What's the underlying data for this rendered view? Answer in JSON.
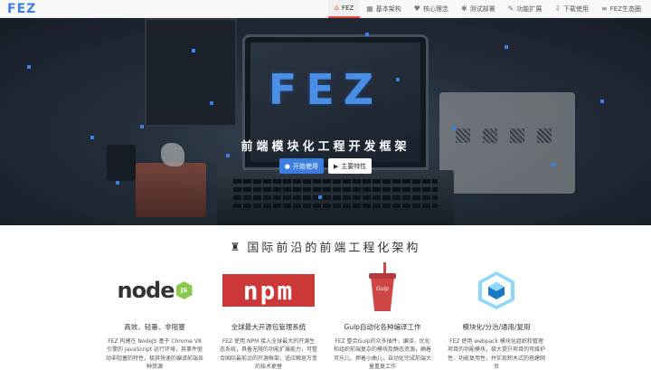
{
  "brand": {
    "name": "FEZ"
  },
  "nav": {
    "items": [
      {
        "label": "FEZ",
        "icon": "home-icon",
        "glyph": "⌂",
        "active": true
      },
      {
        "label": "基本架构",
        "icon": "grid-icon",
        "glyph": "▦"
      },
      {
        "label": "核心理念",
        "icon": "heart-icon",
        "glyph": "♥"
      },
      {
        "label": "测试部署",
        "icon": "bug-icon",
        "glyph": "✱"
      },
      {
        "label": "功能扩展",
        "icon": "tools-icon",
        "glyph": "✎"
      },
      {
        "label": "下载使用",
        "icon": "download-icon",
        "glyph": "⇩"
      },
      {
        "label": "FEZ生态圈",
        "icon": "bars-icon",
        "glyph": "≡"
      }
    ]
  },
  "hero": {
    "logo": "FEZ",
    "subtitle": "前端模块化工程开发框架",
    "btn_start": "开始使用",
    "btn_features": "主要特性"
  },
  "section": {
    "title": "国际前沿的前端工程化架构"
  },
  "features": [
    {
      "logo": "node",
      "logo_text": "node",
      "logo_badge": "JS",
      "title": "高效、轻量、非阻塞",
      "desc": "FEZ 构建在 NodeJS 基于 Chrome V8 引擎的 JavaScript 运行环境，其事件驱动非阻塞的特性，极其快速的编译前端各种资源"
    },
    {
      "logo": "npm",
      "logo_text": "npm",
      "title": "全球最大开源包管理系统",
      "desc": "FEZ 使用 NPM 接入全球最大的开源生态系统，具备无限的功能扩展能力，可整合国际最前沿的开源框架，适应瞬息万变的技术更替"
    },
    {
      "logo": "gulp",
      "logo_text": "Gulp",
      "title": "Gulp自动化各种编译工作",
      "desc": "FEZ 整合Gulp的众多插件，编译、优化和组织前端复杂的模块及静态资源，确着可乐儿、押着小曲儿，自动化完成前端大量重复工作"
    },
    {
      "logo": "webpack",
      "title": "模块化/分治/通用/复用",
      "desc": "FEZ 使用 webpack 模块化组织和管理项目的功能模块，极大提升项目的可维护性、功能复用性，并实现积木式的搭建网页"
    }
  ],
  "colors": {
    "accent": "#3d7ee1",
    "nav_active": "#e84d3d",
    "npm": "#cb3837",
    "node_green": "#8cc84b",
    "gulp": "#cf4646",
    "webpack": "#8ed6fb"
  }
}
